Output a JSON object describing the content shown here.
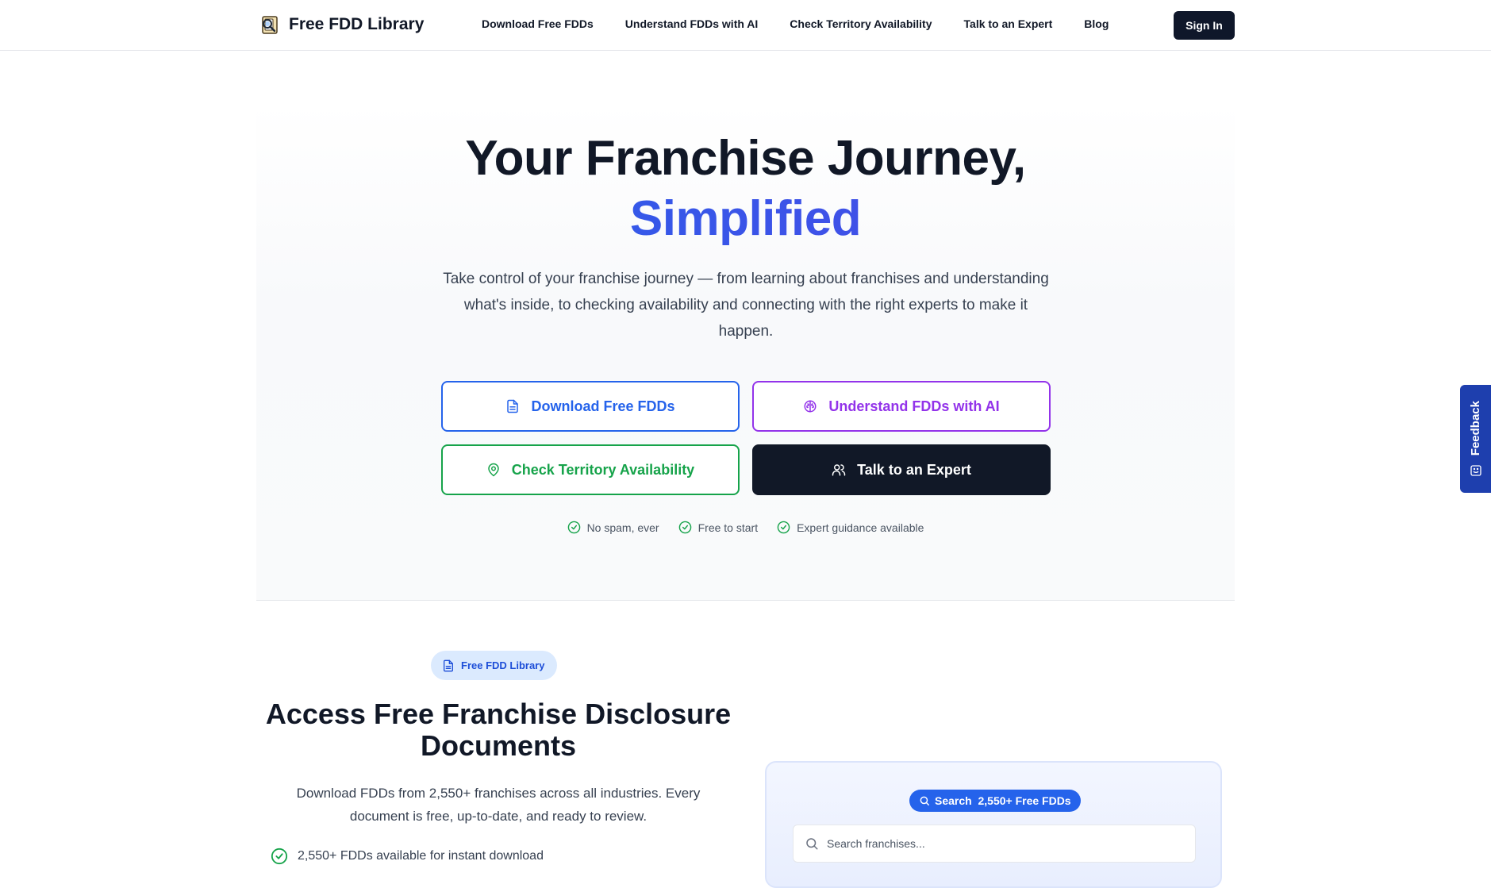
{
  "nav": {
    "brand": "Free FDD Library",
    "links": [
      "Download Free FDDs",
      "Understand FDDs with AI",
      "Check Territory Availability",
      "Talk to an Expert",
      "Blog"
    ],
    "signin": "Sign In"
  },
  "hero": {
    "title_line1": "Your Franchise Journey,",
    "title_line2": "Simplified",
    "subtitle": "Take control of your franchise journey — from learning about franchises and understanding what's inside, to checking availability and connecting with the right experts to make it happen.",
    "cta": {
      "download": "Download Free FDDs",
      "understand": "Understand FDDs with AI",
      "territory": "Check Territory Availability",
      "expert": "Talk to an Expert"
    },
    "trust": [
      "No spam, ever",
      "Free to start",
      "Expert guidance available"
    ]
  },
  "library": {
    "badge": "Free FDD Library",
    "title": "Access Free Franchise Disclosure Documents",
    "subtitle": "Download FDDs from 2,550+ franchises across all industries. Every document is free, up-to-date, and ready to review.",
    "feature": "2,550+ FDDs available for instant download",
    "search_pill": "Search  2,550+ Free FDDs",
    "search_placeholder": "Search franchises..."
  },
  "feedback": {
    "label": "Feedback"
  },
  "colors": {
    "primary_blue": "#2563eb",
    "purple": "#9333ea",
    "green": "#16a34a",
    "dark": "#111827",
    "feedback_tab": "#1e3fae"
  },
  "icons": [
    "library-logo-icon",
    "document-icon",
    "brain-icon",
    "map-pin-icon",
    "users-icon",
    "check-circle-icon",
    "search-icon",
    "smile-icon"
  ]
}
